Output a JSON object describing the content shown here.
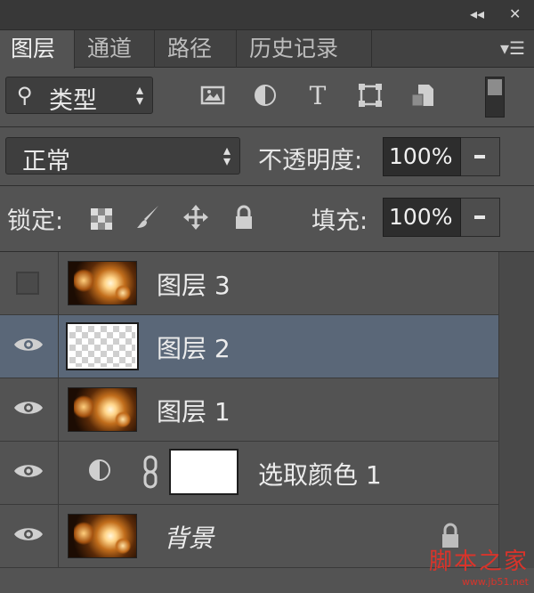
{
  "window_controls": {
    "collapse": "◂◂",
    "close": "✕"
  },
  "tabs": [
    {
      "label": "图层",
      "active": true
    },
    {
      "label": "通道",
      "active": false
    },
    {
      "label": "路径",
      "active": false
    },
    {
      "label": "历史记录",
      "active": false
    }
  ],
  "panel_menu_icon": "panel-menu-icon",
  "filter": {
    "kind_label": "类型",
    "icons": [
      "image-filter-icon",
      "adjustment-filter-icon",
      "type-filter-icon",
      "shape-filter-icon",
      "smart-object-filter-icon"
    ]
  },
  "blend": {
    "mode": "正常",
    "opacity_label": "不透明度:",
    "opacity_value": "100%"
  },
  "lock": {
    "label": "锁定:",
    "fill_label": "填充:",
    "fill_value": "100%"
  },
  "layers": [
    {
      "name": "图层 3",
      "visible": false,
      "type": "image"
    },
    {
      "name": "图层 2",
      "visible": true,
      "type": "transparent",
      "selected": true
    },
    {
      "name": "图层 1",
      "visible": true,
      "type": "image"
    },
    {
      "name": "选取颜色 1",
      "visible": true,
      "type": "adjustment"
    },
    {
      "name": "背景",
      "visible": true,
      "type": "background",
      "locked": true
    }
  ],
  "watermark": {
    "cn": "脚本之家",
    "url": "www.jb51.net"
  },
  "colors": {
    "panel": "#535353",
    "selected_row": "#5a6778",
    "watermark": "#d9342b"
  }
}
